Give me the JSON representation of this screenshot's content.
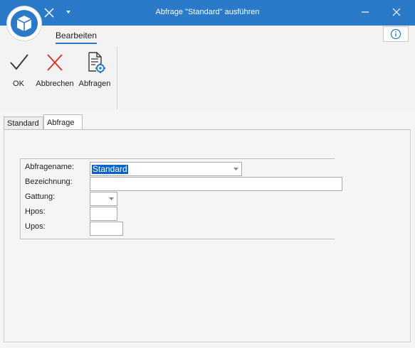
{
  "window": {
    "title": "Abfrage \"Standard\" ausführen"
  },
  "ribbon": {
    "tab_label": "Bearbeiten",
    "buttons": [
      {
        "label": "OK",
        "icon": "checkmark-icon"
      },
      {
        "label": "Abbrechen",
        "icon": "cancel-x-icon"
      },
      {
        "label": "Abfragen",
        "icon": "query-document-gear-icon"
      }
    ]
  },
  "tabs": [
    {
      "label": "Standard",
      "active": false
    },
    {
      "label": "Abfrage",
      "active": true
    }
  ],
  "form": {
    "abfragename": {
      "label": "Abfragename:",
      "value": "Standard"
    },
    "bezeichnung": {
      "label": "Bezeichnung:",
      "value": ""
    },
    "gattung": {
      "label": "Gattung:",
      "value": ""
    },
    "hpos": {
      "label": "Hpos:",
      "value": ""
    },
    "upos": {
      "label": "Upos:",
      "value": ""
    }
  },
  "colors": {
    "accent": "#2b79c9",
    "selection": "#0a64c8",
    "cancel": "#e0362f"
  }
}
